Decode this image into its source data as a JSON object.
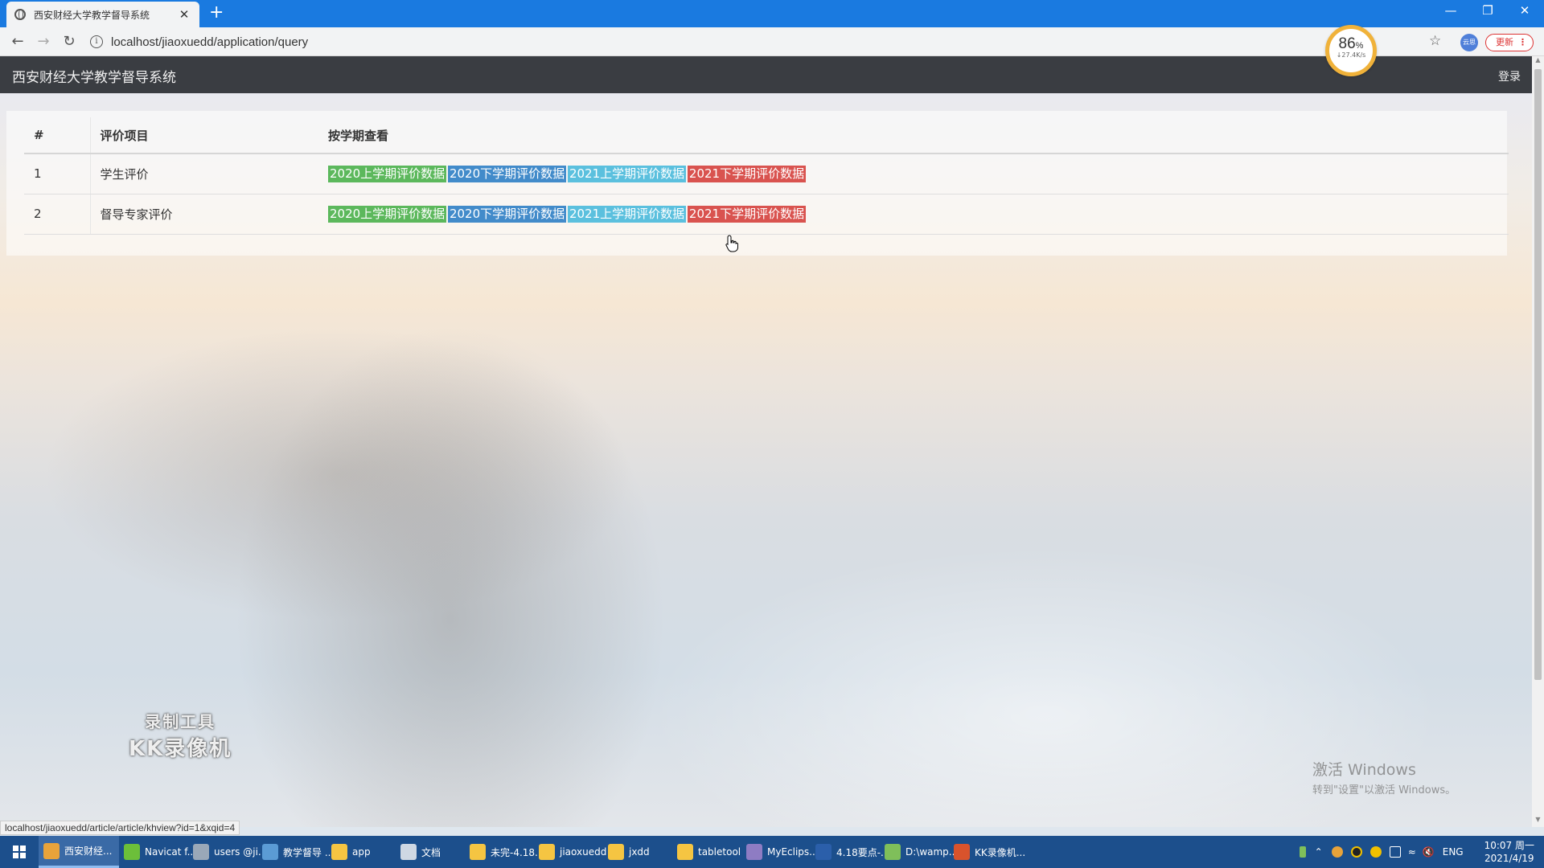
{
  "browser": {
    "tab_title": "西安财经大学教学督导系统",
    "tab_close": "✕",
    "new_tab": "+",
    "url": "localhost/jiaoxuedd/application/query",
    "update_label": "更新",
    "profile_label": "云思"
  },
  "speed_widget": {
    "percent": "86",
    "percent_unit": "%",
    "rate": "↓27.4K/s"
  },
  "app": {
    "brand": "西安财经大学教学督导系统",
    "login": "登录"
  },
  "table": {
    "headers": [
      "#",
      "评价项目",
      "按学期查看"
    ],
    "rows": [
      {
        "num": "1",
        "item": "学生评价",
        "links": [
          "2020上学期评价数据",
          "2020下学期评价数据",
          "2021上学期评价数据",
          "2021下学期评价数据"
        ]
      },
      {
        "num": "2",
        "item": "督导专家评价",
        "links": [
          "2020上学期评价数据",
          "2020下学期评价数据",
          "2021上学期评价数据",
          "2021下学期评价数据"
        ]
      }
    ]
  },
  "link_colors": {
    "green": "#5cb85c",
    "blue": "#428bca",
    "teal": "#5bc0de",
    "red": "#d9534f"
  },
  "watermark": {
    "line1": "录制工具",
    "line2": "KK录像机"
  },
  "activate": {
    "line1": "激活 Windows",
    "line2": "转到\"设置\"以激活 Windows。"
  },
  "status_url": "localhost/jiaoxuedd/article/article/khview?id=1&xqid=4",
  "taskbar": {
    "items": [
      {
        "label": "西安财经...",
        "icon": "chrome-icon",
        "color": "#e8a33a"
      },
      {
        "label": "Navicat f...",
        "icon": "navicat-icon",
        "color": "#6cbf3a"
      },
      {
        "label": "users @ji...",
        "icon": "db-table-icon",
        "color": "#9aa8b8"
      },
      {
        "label": "教学督导 ...",
        "icon": "box-icon",
        "color": "#5b9bd5"
      },
      {
        "label": "app",
        "icon": "folder-icon",
        "color": "#f5c542"
      },
      {
        "label": "文档",
        "icon": "document-icon",
        "color": "#cfd8e3"
      },
      {
        "label": "未完-4.18...",
        "icon": "folder-icon",
        "color": "#f5c542"
      },
      {
        "label": "jiaoxuedd",
        "icon": "folder-icon",
        "color": "#f5c542"
      },
      {
        "label": "jxdd",
        "icon": "folder-icon",
        "color": "#f5c542"
      },
      {
        "label": "tabletool",
        "icon": "folder-icon",
        "color": "#f5c542"
      },
      {
        "label": "MyEclips...",
        "icon": "eclipse-icon",
        "color": "#8e7cc3"
      },
      {
        "label": "4.18要点-...",
        "icon": "word-icon",
        "color": "#2b5faa"
      },
      {
        "label": "D:\\wamp...",
        "icon": "notepad-icon",
        "color": "#7fbf5a"
      },
      {
        "label": "KK录像机...",
        "icon": "kk-recorder-icon",
        "color": "#d9532c"
      }
    ],
    "tray": {
      "lang": "ENG",
      "time": "10:07 周一",
      "date": "2021/4/19"
    }
  }
}
